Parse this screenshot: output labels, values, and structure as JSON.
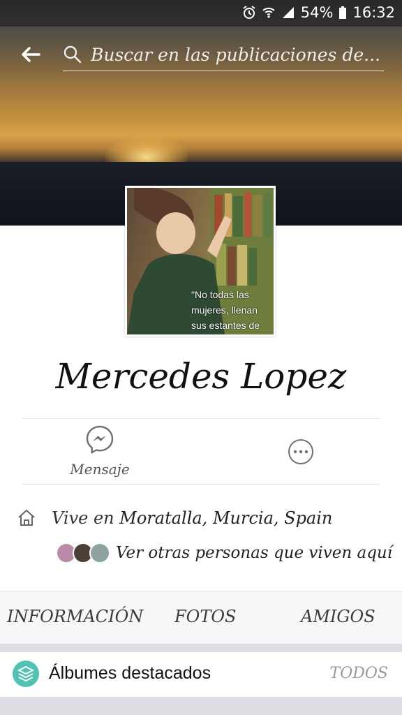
{
  "status_bar": {
    "battery": "54%",
    "time": "16:32"
  },
  "header": {
    "search_placeholder": "Buscar en las publicaciones de..."
  },
  "profile": {
    "name": "Mercedes Lopez",
    "picture_quote_lines": [
      "\"No todas las",
      "mujeres, llenan",
      "sus estantes de"
    ]
  },
  "actions": {
    "message_label": "Mensaje"
  },
  "info": {
    "lives_prefix": "Vive en ",
    "lives_place": "Moratalla, Murcia, Spain",
    "see_others": "Ver otras personas que viven aquí"
  },
  "tabs": {
    "info": "INFORMACIÓN",
    "photos": "FOTOS",
    "friends": "AMIGOS"
  },
  "albums": {
    "title": "Álbumes destacados",
    "all": "TODOS"
  },
  "colors": {
    "accent": "#4fc2b3",
    "messenger": "#6b6f76"
  }
}
